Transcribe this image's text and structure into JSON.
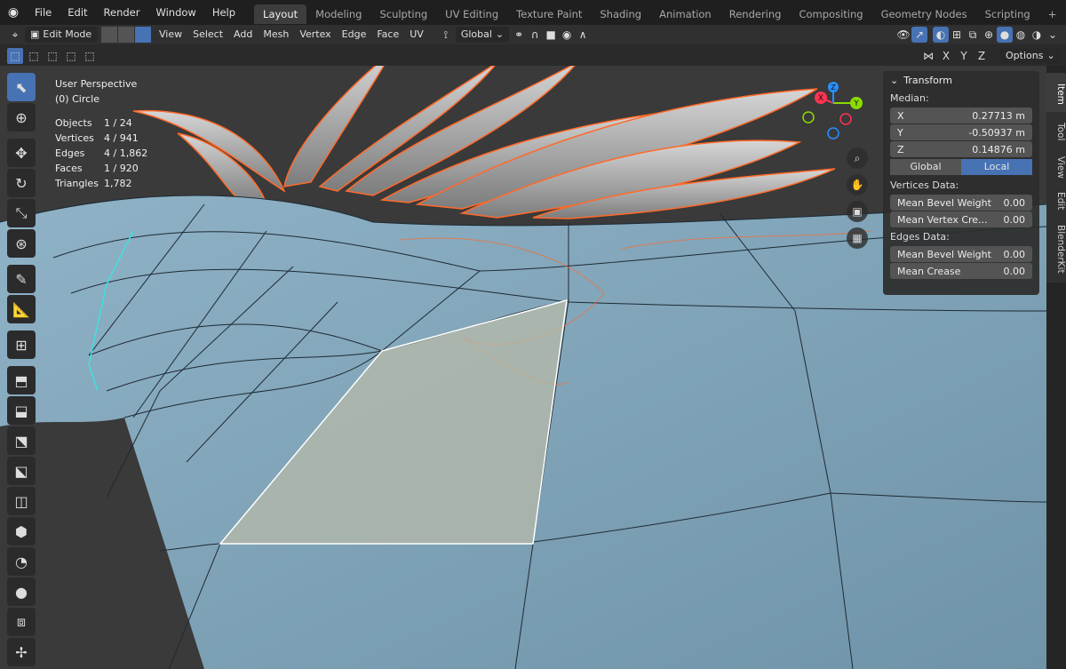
{
  "menu": [
    "File",
    "Edit",
    "Render",
    "Window",
    "Help"
  ],
  "workspaces": [
    {
      "label": "Layout",
      "active": true
    },
    {
      "label": "Modeling"
    },
    {
      "label": "Sculpting"
    },
    {
      "label": "UV Editing"
    },
    {
      "label": "Texture Paint"
    },
    {
      "label": "Shading"
    },
    {
      "label": "Animation"
    },
    {
      "label": "Rendering"
    },
    {
      "label": "Compositing"
    },
    {
      "label": "Geometry Nodes"
    },
    {
      "label": "Scripting"
    }
  ],
  "header": {
    "mode": "Edit Mode",
    "view_menu": [
      "View",
      "Select",
      "Add",
      "Mesh",
      "Vertex",
      "Edge",
      "Face",
      "UV"
    ],
    "orientation": "Global",
    "options_label": "Options",
    "axes": [
      "X",
      "Y",
      "Z"
    ]
  },
  "overlay": {
    "perspective": "User Perspective",
    "object": "(0) Circle",
    "stats": [
      {
        "k": "Objects",
        "v": "1 / 24"
      },
      {
        "k": "Vertices",
        "v": "4 / 941"
      },
      {
        "k": "Edges",
        "v": "4 / 1,862"
      },
      {
        "k": "Faces",
        "v": "1 / 920"
      },
      {
        "k": "Triangles",
        "v": "1,782"
      }
    ]
  },
  "gizmo": {
    "x": "X",
    "y": "Y",
    "z": "Z"
  },
  "npanel": {
    "title": "Transform",
    "median_label": "Median:",
    "x_label": "X",
    "x": "0.27713 m",
    "y_label": "Y",
    "y": "-0.50937 m",
    "z_label": "Z",
    "z": "0.14876 m",
    "global": "Global",
    "local": "Local",
    "vertices_data": "Vertices Data:",
    "mean_bevel_weight": "Mean Bevel Weight",
    "mbw_val": "0.00",
    "mean_vertex_crease": "Mean Vertex Cre...",
    "mvc_val": "0.00",
    "edges_data": "Edges Data:",
    "mean_bevel_weight_e": "Mean Bevel Weight",
    "mbwe_val": "0.00",
    "mean_crease": "Mean Crease",
    "mc_val": "0.00"
  },
  "sidetabs": [
    "Item",
    "Tool",
    "View",
    "Edit",
    "BlenderKit"
  ],
  "colors": {
    "accent": "#4772b3",
    "mesh": "#7fa3b8",
    "selection": "#ff8a3d"
  }
}
